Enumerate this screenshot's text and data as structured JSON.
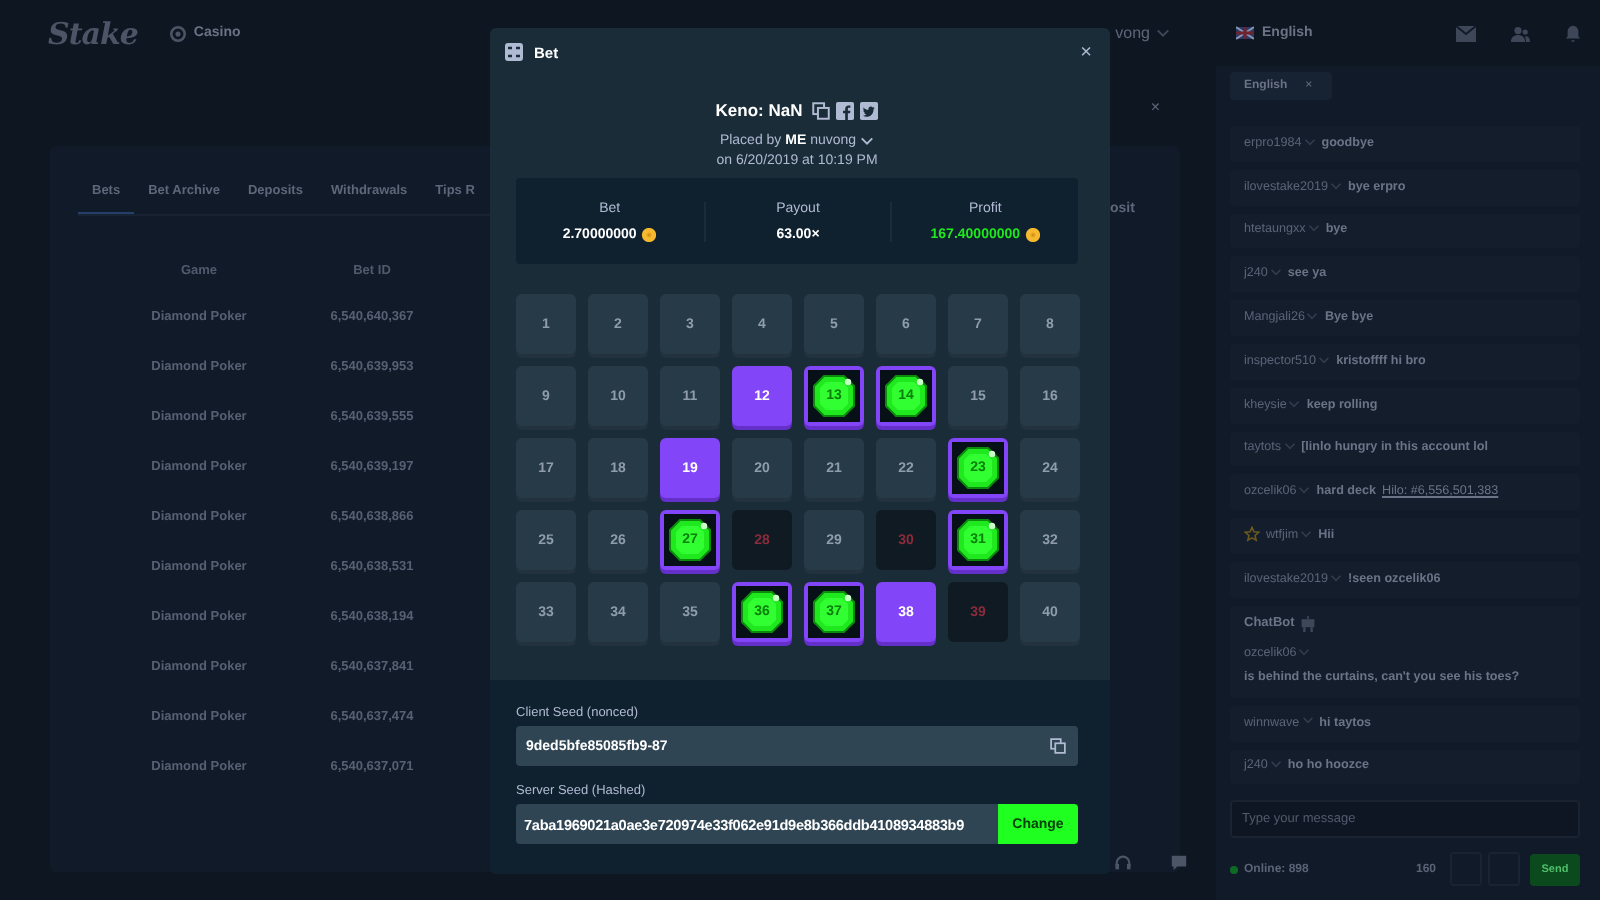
{
  "topbar": {
    "logo": "Stake",
    "nav": "Casino",
    "user": "vong"
  },
  "history": {
    "close": "×",
    "tabs": [
      {
        "label": "Bets",
        "selected": true
      },
      {
        "label": "Bet Archive",
        "selected": false
      },
      {
        "label": "Deposits",
        "selected": false
      },
      {
        "label": "Withdrawals",
        "selected": false
      },
      {
        "label": "Tips R",
        "selected": false
      }
    ],
    "tab_right": "osit",
    "columns": [
      "Game",
      "Bet ID"
    ],
    "rows": [
      [
        "Diamond Poker",
        "6,540,640,367"
      ],
      [
        "Diamond Poker",
        "6,540,639,953"
      ],
      [
        "Diamond Poker",
        "6,540,639,555"
      ],
      [
        "Diamond Poker",
        "6,540,639,197"
      ],
      [
        "Diamond Poker",
        "6,540,638,866"
      ],
      [
        "Diamond Poker",
        "6,540,638,531"
      ],
      [
        "Diamond Poker",
        "6,540,638,194"
      ],
      [
        "Diamond Poker",
        "6,540,637,841"
      ],
      [
        "Diamond Poker",
        "6,540,637,474"
      ],
      [
        "Diamond Poker",
        "6,540,637,071"
      ]
    ]
  },
  "modal": {
    "title": "Bet",
    "close": "×",
    "game": "Keno: NaN",
    "placed_by": "Placed by **ME** nuvong",
    "date": "on 6/20/2019 at 10:19 PM",
    "stats": [
      {
        "label": "Bet",
        "value": "2.70000000",
        "coin": true,
        "positive": false
      },
      {
        "label": "Payout",
        "value": "63.00×",
        "coin": false,
        "positive": false
      },
      {
        "label": "Profit",
        "value": "167.40000000",
        "coin": true,
        "positive": true
      }
    ],
    "tiles": [
      {
        "number": "1",
        "picked": false,
        "drawn": false
      },
      {
        "number": "2",
        "picked": false,
        "drawn": false
      },
      {
        "number": "3",
        "picked": false,
        "drawn": false
      },
      {
        "number": "4",
        "picked": false,
        "drawn": false
      },
      {
        "number": "5",
        "picked": false,
        "drawn": false
      },
      {
        "number": "6",
        "picked": false,
        "drawn": false
      },
      {
        "number": "7",
        "picked": false,
        "drawn": false
      },
      {
        "number": "8",
        "picked": false,
        "drawn": false
      },
      {
        "number": "9",
        "picked": false,
        "drawn": false
      },
      {
        "number": "10",
        "picked": false,
        "drawn": false
      },
      {
        "number": "11",
        "picked": false,
        "drawn": false
      },
      {
        "number": "12",
        "picked": true,
        "drawn": false
      },
      {
        "number": "13",
        "picked": true,
        "drawn": true
      },
      {
        "number": "14",
        "picked": true,
        "drawn": true
      },
      {
        "number": "15",
        "picked": false,
        "drawn": false
      },
      {
        "number": "16",
        "picked": false,
        "drawn": false
      },
      {
        "number": "17",
        "picked": false,
        "drawn": false
      },
      {
        "number": "18",
        "picked": false,
        "drawn": false
      },
      {
        "number": "19",
        "picked": true,
        "drawn": false
      },
      {
        "number": "20",
        "picked": false,
        "drawn": false
      },
      {
        "number": "21",
        "picked": false,
        "drawn": false
      },
      {
        "number": "22",
        "picked": false,
        "drawn": false
      },
      {
        "number": "23",
        "picked": true,
        "drawn": true
      },
      {
        "number": "24",
        "picked": false,
        "drawn": false
      },
      {
        "number": "25",
        "picked": false,
        "drawn": false
      },
      {
        "number": "26",
        "picked": false,
        "drawn": false
      },
      {
        "number": "27",
        "picked": true,
        "drawn": true
      },
      {
        "number": "28",
        "picked": false,
        "drawn": true
      },
      {
        "number": "29",
        "picked": false,
        "drawn": false
      },
      {
        "number": "30",
        "picked": false,
        "drawn": true
      },
      {
        "number": "31",
        "picked": true,
        "drawn": true
      },
      {
        "number": "32",
        "picked": false,
        "drawn": false
      },
      {
        "number": "33",
        "picked": false,
        "drawn": false
      },
      {
        "number": "34",
        "picked": false,
        "drawn": false
      },
      {
        "number": "35",
        "picked": false,
        "drawn": false
      },
      {
        "number": "36",
        "picked": true,
        "drawn": true
      },
      {
        "number": "37",
        "picked": true,
        "drawn": true
      },
      {
        "number": "38",
        "picked": true,
        "drawn": false
      },
      {
        "number": "39",
        "picked": false,
        "drawn": true
      },
      {
        "number": "40",
        "picked": false,
        "drawn": false
      }
    ],
    "seeds": [
      {
        "label": "Client Seed (nonced)",
        "value": "9ded5bfe85085fb9-87",
        "kind": "copy"
      },
      {
        "label": "Server Seed (Hashed)",
        "value": "7aba1969021a0ae3e720974e33f062e91d9e8b366ddb4108934883b9",
        "kind": "change",
        "button": "Change"
      }
    ]
  },
  "chat": {
    "language": "English",
    "room": "English",
    "room_close": "×",
    "messages": [
      {
        "kind": "message",
        "user": "erpro1984",
        "text": "goodbye",
        "vip": false
      },
      {
        "kind": "message",
        "user": "ilovestake2019",
        "text": "bye erpro",
        "vip": false
      },
      {
        "kind": "message",
        "user": "htetaungxx",
        "text": "bye",
        "vip": false
      },
      {
        "kind": "message",
        "user": "j240",
        "text": "see ya",
        "vip": false
      },
      {
        "kind": "message",
        "user": "Mangjali26",
        "text": "Bye bye",
        "vip": false
      },
      {
        "kind": "message",
        "user": "inspector510",
        "text": "kristoffff hi bro",
        "vip": false
      },
      {
        "kind": "message",
        "user": "kheysie",
        "text": "keep rolling",
        "vip": false
      },
      {
        "kind": "message",
        "user": "taytots",
        "text": "[linlo hungry in this account lol",
        "vip": false
      },
      {
        "kind": "message",
        "user": "ozcelik06",
        "text": "hard deck",
        "link": "Hilo: #6,556,501,383",
        "vip": false
      },
      {
        "kind": "message",
        "user": "wtfjim",
        "text": "Hii",
        "vip": true
      },
      {
        "kind": "message",
        "user": "ilovestake2019",
        "text": "!seen ozcelik06",
        "vip": false
      },
      {
        "kind": "bot",
        "bot": "ChatBot",
        "user": "ozcelik06",
        "text": "is behind the curtains, can't you see his toes?",
        "vip": false
      },
      {
        "kind": "message",
        "user": "winnwave",
        "text": "hi taytos",
        "vip": false
      },
      {
        "kind": "message",
        "user": "j240",
        "text": "ho ho hoozce",
        "vip": false
      }
    ],
    "placeholder": "Type your message",
    "online": "Online: 898",
    "count": "160",
    "send": "Send"
  }
}
